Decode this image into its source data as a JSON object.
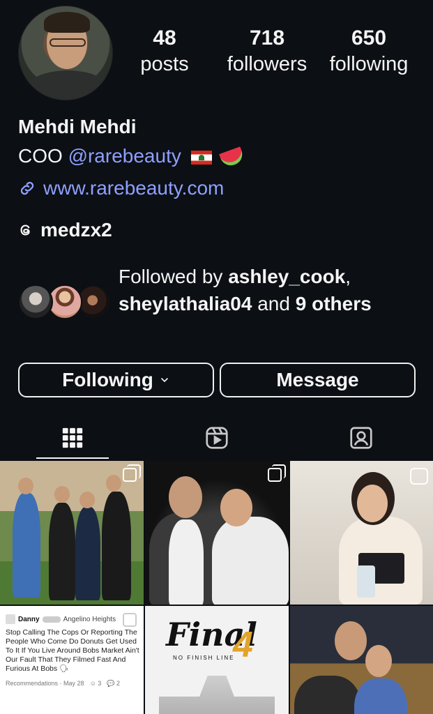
{
  "profile": {
    "name": "Mehdi Mehdi",
    "bio_role": "COO",
    "bio_mention": "@rarebeauty",
    "website": "www.rarebeauty.com",
    "threads_handle": "medzx2"
  },
  "stats": {
    "posts": {
      "value": "48",
      "label": "posts"
    },
    "followers": {
      "value": "718",
      "label": "followers"
    },
    "following": {
      "value": "650",
      "label": "following"
    }
  },
  "mutual": {
    "prefix": "Followed by",
    "user1": "ashley_cook",
    "sep": ",",
    "user2": "sheylathalia04",
    "and": "and",
    "others": "9 others"
  },
  "actions": {
    "following_label": "Following",
    "message_label": "Message"
  },
  "tabs": [
    "grid-tab",
    "reels-tab",
    "tagged-tab"
  ],
  "posts": {
    "text_post": {
      "author": "Danny",
      "location": "Angelino Heights",
      "body": "Stop Calling The Cops Or Reporting The People Who Come Do Donuts Get Used To It If You Live Around Bobs Market Ain't Our Fault That They Filmed Fast And Furious At Bobs 🗣",
      "meta_source": "Recommendations · May 28",
      "meta_reactions": "3",
      "meta_comments": "2"
    },
    "final_post": {
      "title": "Final",
      "number": "4",
      "subtitle": "NO FINISH LINE"
    }
  },
  "colors": {
    "background": "#0c0f14",
    "link": "#8ea0ff",
    "text": "#f5f5f5"
  }
}
